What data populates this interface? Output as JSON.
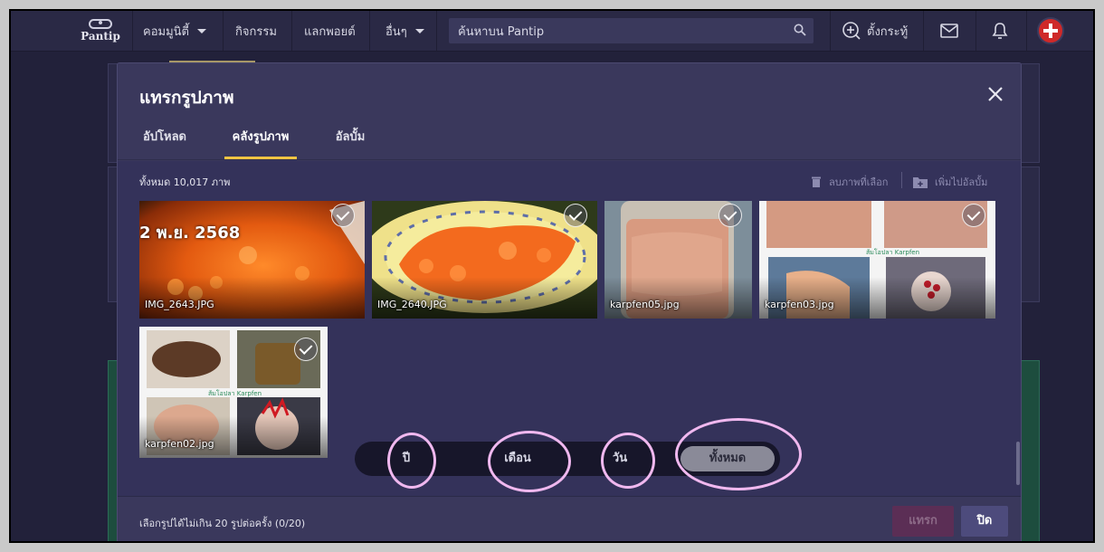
{
  "navbar": {
    "logo_text": "Pantip",
    "community": "คอมมูนิตี้",
    "activity": "กิจกรรม",
    "exchange_points": "แลกพอยต์",
    "others": "อื่นๆ",
    "search_placeholder": "ค้นหาบน Pantip",
    "new_post": "ตั้งกระทู้"
  },
  "modal": {
    "title": "แทรกรูปภาพ",
    "tabs": [
      "อัปโหลด",
      "คลังรูปภาพ",
      "อัลบั้ม"
    ],
    "active_tab": "คลังรูปภาพ",
    "count_text": "ทั้งหมด 10,017 ภาพ",
    "delete_selected": "ลบภาพที่เลือก",
    "add_to_album": "เพิ่มไปอัลบั้ม",
    "images": [
      {
        "name": "IMG_2643.JPG",
        "date_overlay": "2 พ.ย. 2568"
      },
      {
        "name": "IMG_2640.JPG"
      },
      {
        "name": "karpfen05.jpg"
      },
      {
        "name": "karpfen03.jpg",
        "caption": "ส้มโอปลา Karpfen"
      },
      {
        "name": "karpfen02.jpg",
        "caption": "ส้มโอปลา Karpfen"
      }
    ],
    "filter": {
      "options": [
        "ปี",
        "เดือน",
        "วัน",
        "ทั้งหมด"
      ],
      "active": "ทั้งหมด"
    },
    "footer_note": "เลือกรูปได้ไม่เกิน 20 รูปต่อครั้ง (0/20)",
    "insert_button": "แทรก",
    "close_button": "ปิด"
  },
  "colors": {
    "accent_tab_underline": "#f5c542",
    "annotation_ring": "#f0b8ef",
    "avatar": "#cf2929"
  }
}
